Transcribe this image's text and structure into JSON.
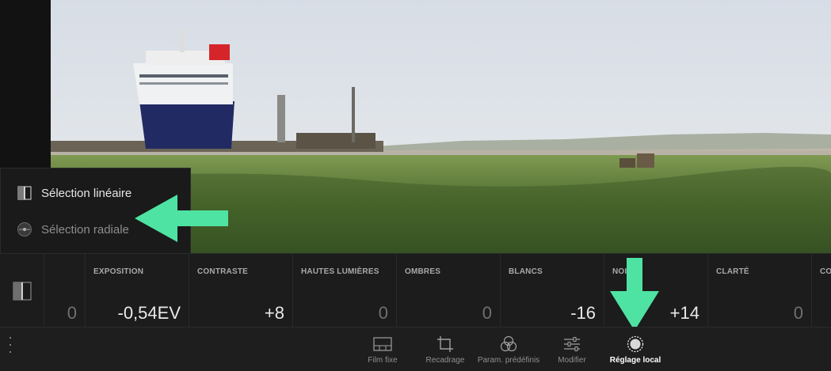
{
  "selection_menu": {
    "linear_label": "Sélection linéaire",
    "radial_label": "Sélection radiale"
  },
  "sliders": [
    {
      "name": "",
      "value": "0",
      "muted": true
    },
    {
      "name": "EXPOSITION",
      "value": "-0,54EV",
      "muted": false
    },
    {
      "name": "CONTRASTE",
      "value": "+8",
      "muted": false
    },
    {
      "name": "HAUTES LUMIÈRES",
      "value": "0",
      "muted": true
    },
    {
      "name": "OMBRES",
      "value": "0",
      "muted": true
    },
    {
      "name": "BLANCS",
      "value": "-16",
      "muted": false
    },
    {
      "name": "NOIRS",
      "value": "+14",
      "muted": false
    },
    {
      "name": "CLARTÉ",
      "value": "0",
      "muted": true
    },
    {
      "name": "CO",
      "value": "",
      "muted": true
    }
  ],
  "toolbar": {
    "film_fixe": "Film fixe",
    "recadrage": "Recadrage",
    "presets": "Param. prédéfinis",
    "modifier": "Modifier",
    "reglage_local": "Réglage local"
  },
  "colors": {
    "arrow": "#4fe3a3",
    "panel": "#1c1c1c",
    "active_label": "#ffffff"
  },
  "icons": {
    "linear": "linear-gradient-icon",
    "radial": "radial-gradient-icon",
    "film": "filmstrip-icon",
    "crop": "crop-icon",
    "presets": "presets-icon",
    "modify": "sliders-icon",
    "local": "local-adjust-icon"
  }
}
